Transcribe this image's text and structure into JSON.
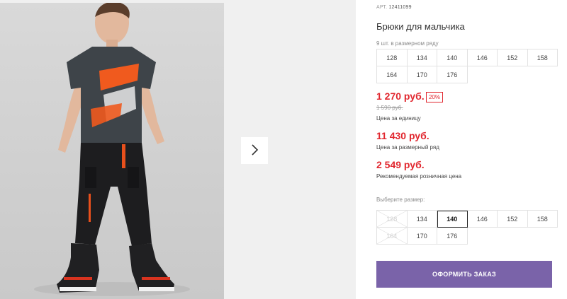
{
  "gallery": {
    "next_icon": "chevron-right-icon"
  },
  "product": {
    "art_label": "АРТ.",
    "art_number": "12411099",
    "title": "Брюки для мальчика",
    "row_count": "9 шт. в размерном ряду",
    "row_sizes": [
      "128",
      "134",
      "140",
      "146",
      "152",
      "158",
      "164",
      "170",
      "176"
    ]
  },
  "prices": {
    "unit_price": "1 270 руб.",
    "discount": "20%",
    "old_price": "1 590 руб.",
    "unit_label": "Цена за единицу",
    "row_price": "11 430 руб.",
    "row_label": "Цена за размерный ряд",
    "rrp_price": "2 549 руб.",
    "rrp_label": "Рекомендуемая розничная цена",
    "accent_color": "#e1272f"
  },
  "size_picker": {
    "label": "Выберите размер:",
    "sizes": [
      {
        "value": "128",
        "state": "unavailable"
      },
      {
        "value": "134",
        "state": "available"
      },
      {
        "value": "140",
        "state": "selected"
      },
      {
        "value": "146",
        "state": "available"
      },
      {
        "value": "152",
        "state": "available"
      },
      {
        "value": "158",
        "state": "available"
      },
      {
        "value": "164",
        "state": "unavailable"
      },
      {
        "value": "170",
        "state": "available"
      },
      {
        "value": "176",
        "state": "available"
      }
    ]
  },
  "order": {
    "button_label": "ОФОРМИТЬ ЗАКАЗ",
    "button_color": "#7a63a9"
  }
}
